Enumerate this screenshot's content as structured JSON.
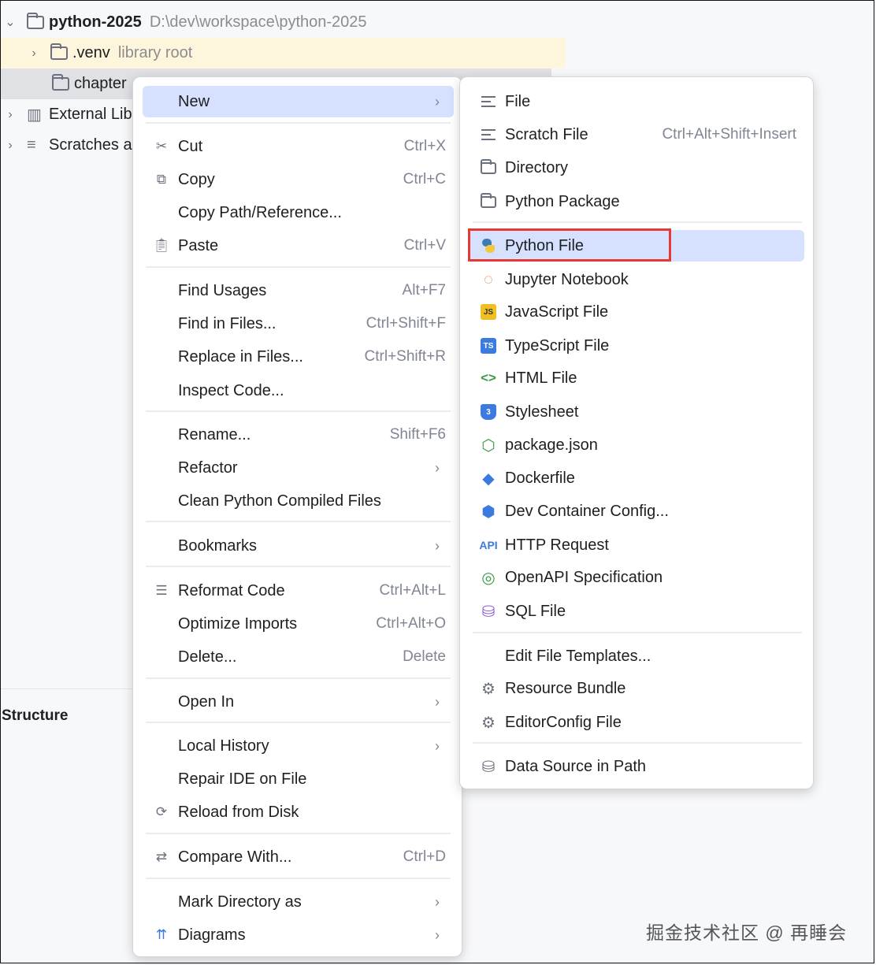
{
  "tree": {
    "root_name": "python-2025",
    "root_path": "D:\\dev\\workspace\\python-2025",
    "venv_name": ".venv",
    "venv_note": "library root",
    "chapter_name": "chapter",
    "external_libs": "External Lib",
    "scratches": "Scratches a",
    "structure_title": "Structure"
  },
  "main_menu": {
    "new": "New",
    "cut": "Cut",
    "cut_sc": "Ctrl+X",
    "copy": "Copy",
    "copy_sc": "Ctrl+C",
    "copy_path": "Copy Path/Reference...",
    "paste": "Paste",
    "paste_sc": "Ctrl+V",
    "find_usages": "Find Usages",
    "find_usages_sc": "Alt+F7",
    "find_in_files": "Find in Files...",
    "find_in_files_sc": "Ctrl+Shift+F",
    "replace_in_files": "Replace in Files...",
    "replace_in_files_sc": "Ctrl+Shift+R",
    "inspect_code": "Inspect Code...",
    "rename": "Rename...",
    "rename_sc": "Shift+F6",
    "refactor": "Refactor",
    "clean_python": "Clean Python Compiled Files",
    "bookmarks": "Bookmarks",
    "reformat": "Reformat Code",
    "reformat_sc": "Ctrl+Alt+L",
    "optimize": "Optimize Imports",
    "optimize_sc": "Ctrl+Alt+O",
    "delete": "Delete...",
    "delete_sc": "Delete",
    "open_in": "Open In",
    "local_history": "Local History",
    "repair_ide": "Repair IDE on File",
    "reload": "Reload from Disk",
    "compare": "Compare With...",
    "compare_sc": "Ctrl+D",
    "mark_dir": "Mark Directory as",
    "diagrams": "Diagrams"
  },
  "sub_menu": {
    "file": "File",
    "scratch": "Scratch File",
    "scratch_sc": "Ctrl+Alt+Shift+Insert",
    "directory": "Directory",
    "python_package": "Python Package",
    "python_file": "Python File",
    "jupyter": "Jupyter Notebook",
    "javascript": "JavaScript File",
    "typescript": "TypeScript File",
    "html": "HTML File",
    "stylesheet": "Stylesheet",
    "package_json": "package.json",
    "dockerfile": "Dockerfile",
    "dev_container": "Dev Container Config...",
    "http_request": "HTTP Request",
    "openapi": "OpenAPI Specification",
    "sql": "SQL File",
    "edit_templates": "Edit File Templates...",
    "resource_bundle": "Resource Bundle",
    "editorconfig": "EditorConfig File",
    "data_source": "Data Source in Path",
    "js_badge": "JS",
    "ts_badge": "TS",
    "api_badge": "API"
  },
  "watermark": "掘金技术社区 @ 再睡会",
  "colors": {
    "highlight": "#d5e1ff",
    "redbox": "#e53935",
    "venv_row": "#fdf5dc"
  }
}
